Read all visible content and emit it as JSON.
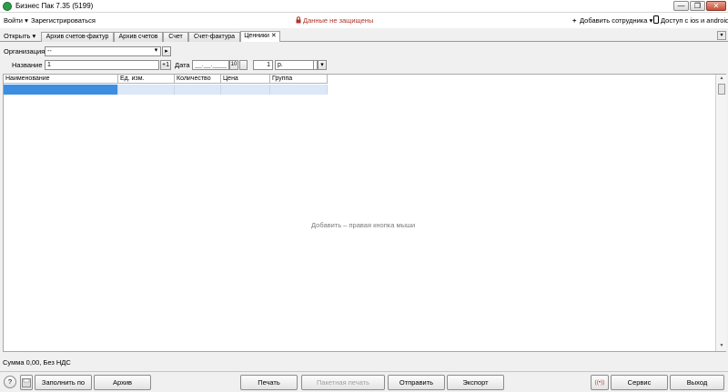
{
  "window": {
    "title": "Бизнес Пак 7.35 (5199)",
    "min_glyph": "—",
    "max_glyph": "❐",
    "close_glyph": "✕"
  },
  "menu": {
    "login": "Войти ▾",
    "register": "Зарегистрироваться",
    "warning": "Данные не защищены",
    "add_employee": "Добавить сотрудника ▾",
    "mobile_access": "Доступ с ios и android"
  },
  "tabs": {
    "open": "Открыть ▾",
    "items": [
      "Архив счетов-фактур",
      "Архив счетов",
      "Счет",
      "Счет-фактура",
      "Ценники ✕"
    ],
    "scroll_glyph": "▾"
  },
  "form": {
    "organization_label": "Организация",
    "organization_value": "--",
    "name_label": "Название",
    "name_value": "1",
    "name_increment": "+1",
    "date_label": "Дата",
    "date_value": "__.__.____",
    "date_day": "10",
    "number_value": "1",
    "currency_value": "р.",
    "dropdown_glyph": "▾",
    "arrow_glyph": "▸"
  },
  "grid": {
    "columns": [
      "Наименование",
      "Ед. изм.",
      "Количество",
      "Цена",
      "Группа"
    ],
    "empty_hint": "Добавить – правая кнопка мыши"
  },
  "status": {
    "sum": "Сумма 0,00, Без НДС"
  },
  "toolbar": {
    "help": "?",
    "fill_by": "Заполнить по",
    "archive": "Архив",
    "print": "Печать",
    "batch_print": "Пакетная печать",
    "send": "Отправить",
    "export": "Экспорт",
    "broadcast": "((•))",
    "service": "Сервис",
    "exit": "Выход"
  },
  "colors": {
    "warning": "#b0342a",
    "selection": "#dce8f7",
    "active_cell": "#3d8ee0"
  }
}
